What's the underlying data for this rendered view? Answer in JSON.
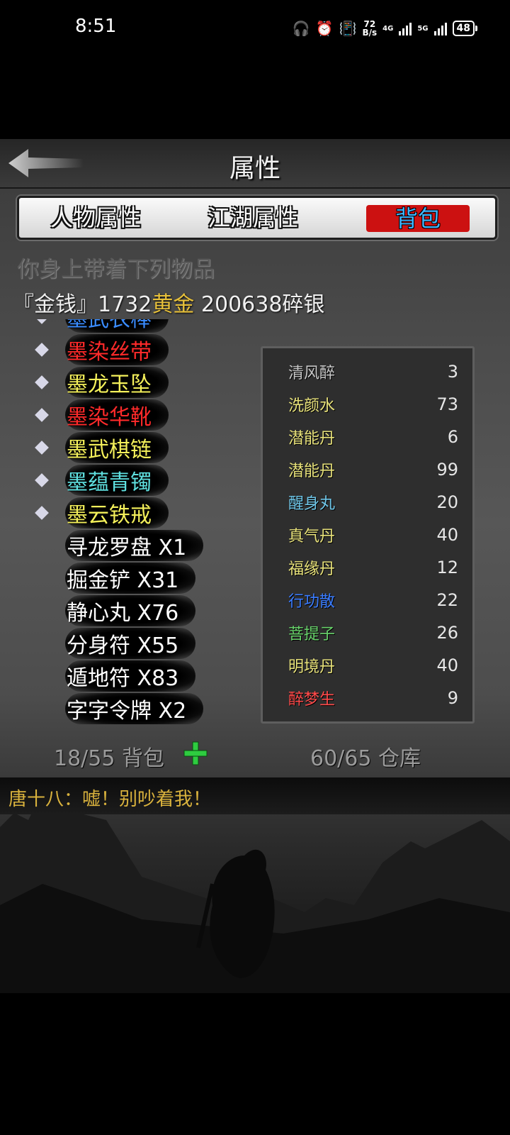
{
  "status_bar": {
    "time": "8:51",
    "speed_value": "72",
    "speed_unit": "B/s",
    "net1": "4G",
    "net2": "5G",
    "battery": "48"
  },
  "header": {
    "title": "属性",
    "back_icon": "back-arrow-icon"
  },
  "tabs": [
    {
      "label": "人物属性",
      "active": false
    },
    {
      "label": "江湖属性",
      "active": false
    },
    {
      "label": "背包",
      "active": true
    }
  ],
  "inventory": {
    "title": "你身上带着下列物品",
    "money_prefix": "『金钱』1732",
    "money_gold": "黄金",
    "money_suffix": " 200638碎银",
    "items": [
      {
        "name": "墨武衣棒",
        "color": "#3a8cff",
        "marked": true,
        "partial": true
      },
      {
        "name": "墨染丝带",
        "color": "#ff2a2a",
        "marked": true
      },
      {
        "name": "墨龙玉坠",
        "color": "#f3ef5a",
        "marked": true
      },
      {
        "name": "墨染华靴",
        "color": "#ff2a2a",
        "marked": true
      },
      {
        "name": "墨武棋链",
        "color": "#f3ef5a",
        "marked": true
      },
      {
        "name": "墨蕴青镯",
        "color": "#5fe0e0",
        "marked": true
      },
      {
        "name": "墨云铁戒",
        "color": "#f3ef5a",
        "marked": true
      },
      {
        "name": "寻龙罗盘 X1",
        "color": "#ffffff",
        "marked": false
      },
      {
        "name": "掘金铲 X31",
        "color": "#ffffff",
        "marked": false
      },
      {
        "name": "静心丸 X76",
        "color": "#ffffff",
        "marked": false
      },
      {
        "name": "分身符 X55",
        "color": "#ffffff",
        "marked": false
      },
      {
        "name": "遁地符 X83",
        "color": "#ffffff",
        "marked": false
      },
      {
        "name": "字字令牌 X2",
        "color": "#ffffff",
        "marked": false
      }
    ],
    "consumables": [
      {
        "name": "清风醉",
        "count": "3",
        "color": "#c8c8c8"
      },
      {
        "name": "洗颜水",
        "count": "73",
        "color": "#e8e27a"
      },
      {
        "name": "潜能丹",
        "count": "6",
        "color": "#e8e27a"
      },
      {
        "name": "潜能丹",
        "count": "99",
        "color": "#e8e27a"
      },
      {
        "name": "醒身丸",
        "count": "20",
        "color": "#6fc6e8"
      },
      {
        "name": "真气丹",
        "count": "40",
        "color": "#e8e27a"
      },
      {
        "name": "福缘丹",
        "count": "12",
        "color": "#e8e27a"
      },
      {
        "name": "行功散",
        "count": "22",
        "color": "#3a7cff"
      },
      {
        "name": "菩提子",
        "count": "26",
        "color": "#67d16a"
      },
      {
        "name": "明境丹",
        "count": "40",
        "color": "#e8e27a"
      },
      {
        "name": "醉梦生",
        "count": "9",
        "color": "#ff4a4a"
      }
    ],
    "bag_count": "18/55 背包",
    "store_count": "60/65 仓库"
  },
  "chat": {
    "message": "唐十八：嘘！别吵着我！"
  }
}
